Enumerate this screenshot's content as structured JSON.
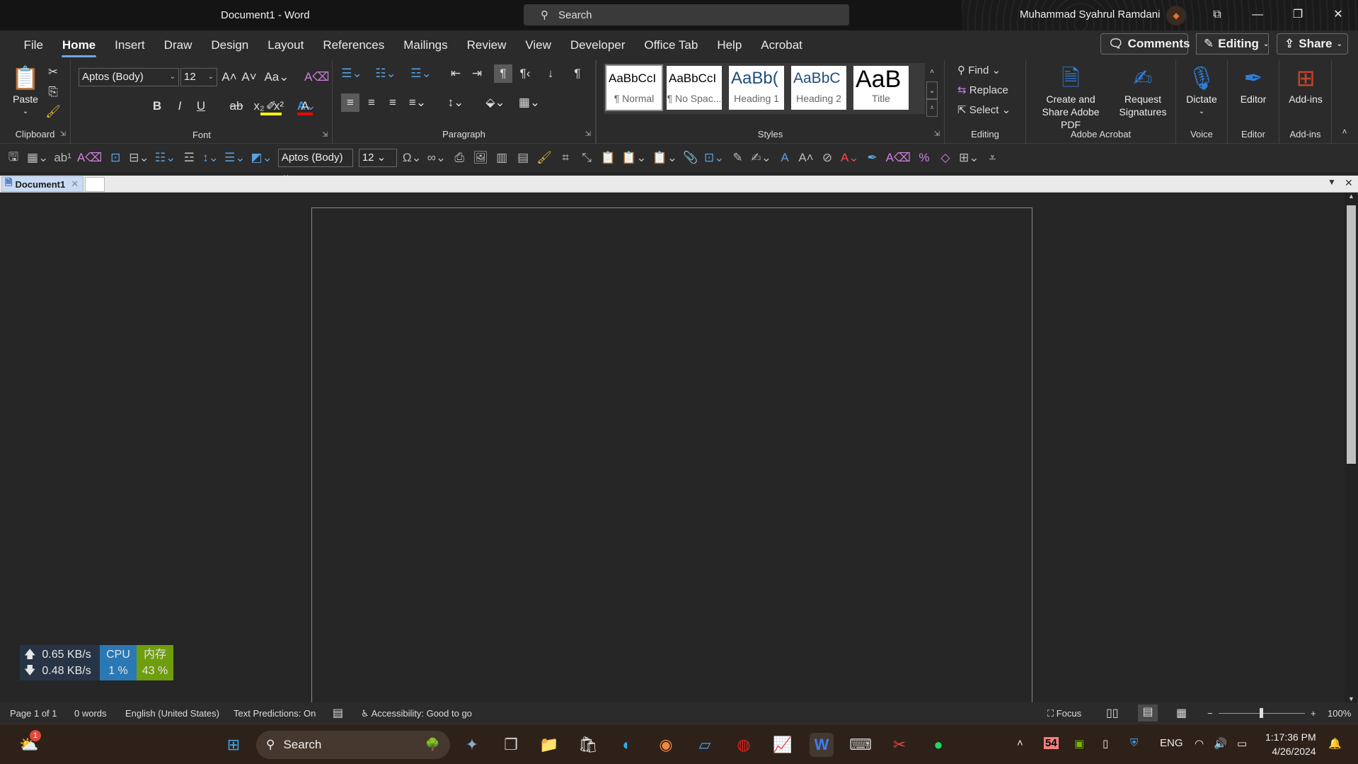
{
  "window": {
    "title": "Document1  -  Word",
    "search": "Search",
    "user": "Muhammad Syahrul Ramdani"
  },
  "menu": {
    "tabs": [
      "File",
      "Home",
      "Insert",
      "Draw",
      "Design",
      "Layout",
      "References",
      "Mailings",
      "Review",
      "View",
      "Developer",
      "Office Tab",
      "Help",
      "Acrobat"
    ],
    "active": "Home",
    "comments": "Comments",
    "editing": "Editing",
    "share": "Share"
  },
  "ribbon": {
    "clipboard": {
      "label": "Clipboard",
      "paste": "Paste"
    },
    "font": {
      "label": "Font",
      "name": "Aptos (Body)",
      "size": "12",
      "change_case": "Aa",
      "bold": "B",
      "italic": "I",
      "underline": "U",
      "strike": "ab",
      "subscript": "x₂",
      "superscript": "x²",
      "highlight_color": "#ffff00",
      "font_color": "#ff0000"
    },
    "paragraph": {
      "label": "Paragraph"
    },
    "styles": {
      "label": "Styles",
      "items": [
        {
          "preview": "AaBbCcI",
          "name": "¶ Normal"
        },
        {
          "preview": "AaBbCcI",
          "name": "¶ No Spac..."
        },
        {
          "preview": "AaBb(",
          "name": "Heading 1"
        },
        {
          "preview": "AaBbC",
          "name": "Heading 2"
        },
        {
          "preview": "AaB",
          "name": "Title"
        }
      ]
    },
    "editing": {
      "label": "Editing",
      "find": "Find",
      "replace": "Replace",
      "select": "Select"
    },
    "acrobat": {
      "label": "Adobe Acrobat",
      "create": "Create and Share Adobe PDF",
      "request": "Request Signatures"
    },
    "voice": {
      "label": "Voice",
      "dictate": "Dictate"
    },
    "editor": {
      "label": "Editor",
      "button": "Editor"
    },
    "addins": {
      "label": "Add-ins",
      "button": "Add-ins"
    }
  },
  "qat": {
    "font": "Aptos (Body)",
    "size": "12"
  },
  "doc_tab": {
    "name": "Document1"
  },
  "network": {
    "up": "0.65 KB/s",
    "down": "0.48 KB/s",
    "cpu_label": "CPU",
    "cpu": "1 %",
    "mem_label": "内存",
    "mem": "43 %"
  },
  "status": {
    "page": "Page 1 of 1",
    "words": "0 words",
    "language": "English (United States)",
    "predictions": "Text Predictions: On",
    "accessibility": "Accessibility: Good to go",
    "focus": "Focus",
    "zoom": "100%",
    "zoom_percent": 100
  },
  "taskbar": {
    "search": "Search",
    "weather_badge": "1",
    "tray_temp": "54",
    "lang": "ENG",
    "time": "1:17:36 PM",
    "date": "4/26/2024"
  }
}
